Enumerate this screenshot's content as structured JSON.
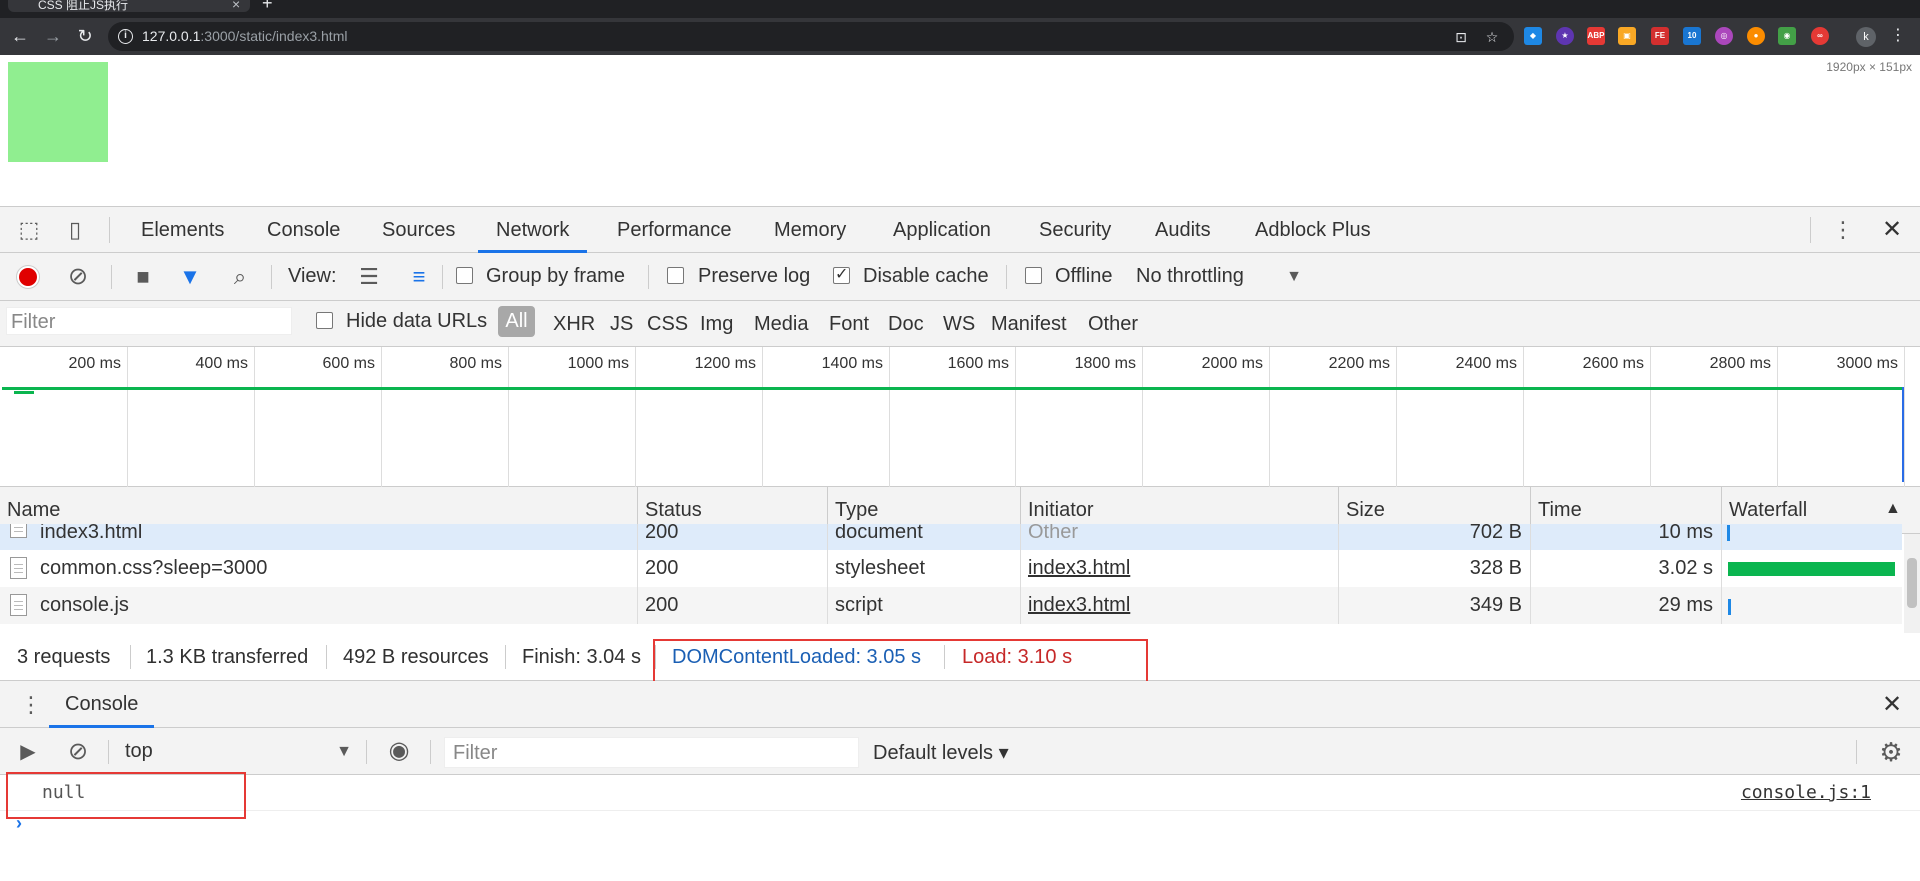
{
  "browser": {
    "tab_title": "CSS 阻止JS执行",
    "tab_close": "×",
    "new_tab": "+",
    "url_host": "127.0.0.1",
    "url_rest": ":3000/static/index3.html",
    "back_icon": "←",
    "forward_icon": "→",
    "reload_icon": "↻",
    "profile_initial": "k",
    "menu_icon": "⋮",
    "extensions": [
      {
        "name": "abp-ext",
        "color": "#e53935",
        "text": "ABP"
      },
      {
        "name": "fe-ext",
        "color": "#d32f2f",
        "text": "FE"
      },
      {
        "name": "badge-ext",
        "color": "#1976d2",
        "text": "10"
      }
    ]
  },
  "page": {
    "box_color": "#90ee90",
    "dimension_overlay": "1920px × 151px"
  },
  "devtools": {
    "tabs": [
      "Elements",
      "Console",
      "Sources",
      "Network",
      "Performance",
      "Memory",
      "Application",
      "Security",
      "Audits",
      "Adblock Plus"
    ],
    "active_tab": "Network",
    "toolbar": {
      "view_label": "View:",
      "group_by_frame": "Group by frame",
      "preserve_log": "Preserve log",
      "disable_cache": "Disable cache",
      "offline": "Offline",
      "throttling": "No throttling",
      "disable_cache_checked": true
    },
    "filter": {
      "placeholder": "Filter",
      "hide_data_urls": "Hide data URLs",
      "types": [
        "All",
        "XHR",
        "JS",
        "CSS",
        "Img",
        "Media",
        "Font",
        "Doc",
        "WS",
        "Manifest",
        "Other"
      ],
      "active_type": "All"
    },
    "timeline": {
      "ticks": [
        "200 ms",
        "400 ms",
        "600 ms",
        "800 ms",
        "1000 ms",
        "1200 ms",
        "1400 ms",
        "1600 ms",
        "1800 ms",
        "2000 ms",
        "2200 ms",
        "2400 ms",
        "2600 ms",
        "2800 ms",
        "3000 ms"
      ]
    },
    "table": {
      "headers": [
        "Name",
        "Status",
        "Type",
        "Initiator",
        "Size",
        "Time",
        "Waterfall"
      ],
      "sort_indicator": "▲",
      "rows": [
        {
          "name": "index3.html",
          "status": "200",
          "type": "document",
          "initiator": "Other",
          "size": "702 B",
          "time": "10 ms",
          "selected": true,
          "wf_start": 0.005,
          "wf_width": 0.003,
          "wf_color": "#1e88e5"
        },
        {
          "name": "common.css?sleep=3000",
          "status": "200",
          "type": "stylesheet",
          "initiator": "index3.html",
          "size": "328 B",
          "time": "3.02 s",
          "selected": false,
          "wf_start": 0.01,
          "wf_width": 0.96,
          "wf_color": "#0ab54f"
        },
        {
          "name": "console.js",
          "status": "200",
          "type": "script",
          "initiator": "index3.html",
          "size": "349 B",
          "time": "29 ms",
          "selected": false,
          "wf_start": 0.01,
          "wf_width": 0.01,
          "wf_color": "#1e88e5"
        }
      ]
    },
    "summary": {
      "requests": "3 requests",
      "transferred": "1.3 KB transferred",
      "resources": "492 B resources",
      "finish": "Finish: 3.04 s",
      "dom_content_loaded": "DOMContentLoaded: 3.05 s",
      "load": "Load: 3.10 s",
      "dcl_color": "#1a5fb4",
      "load_color": "#c62828"
    },
    "drawer": {
      "tab": "Console",
      "context": "top",
      "filter_placeholder": "Filter",
      "levels": "Default levels ▾",
      "log_value": "null",
      "log_source": "console.js:1",
      "prompt": "›"
    }
  }
}
